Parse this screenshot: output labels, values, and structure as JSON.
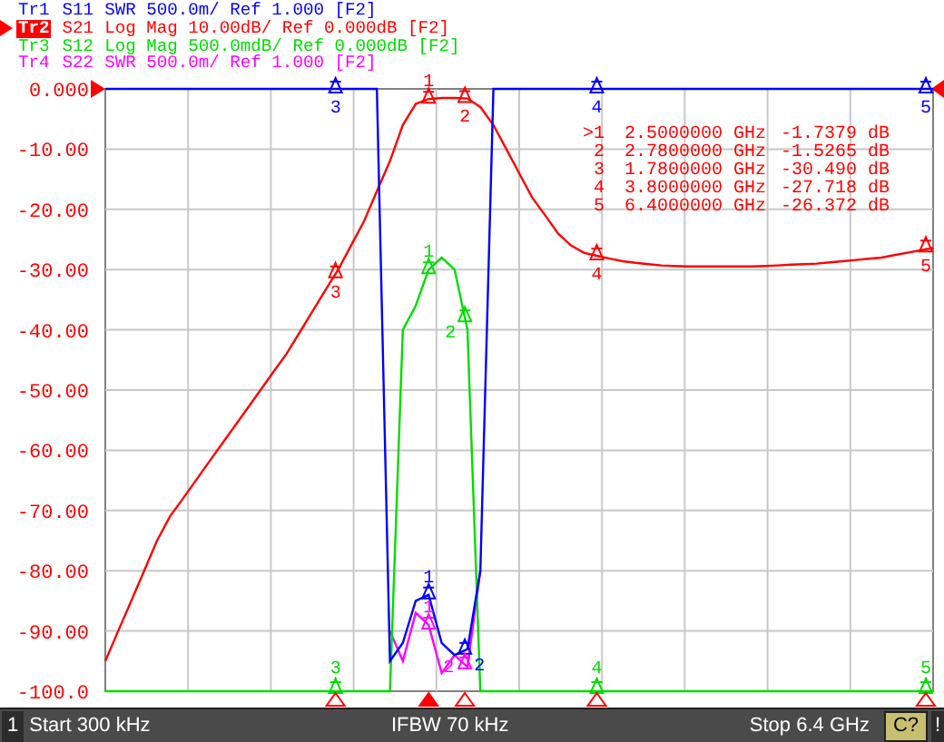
{
  "traces": [
    {
      "name": "Tr1",
      "format": "SWR 500.0m/ Ref 1.000 [F2]",
      "selected": false,
      "marker_labels": [
        "1",
        "2",
        "3",
        "4",
        "5"
      ]
    },
    {
      "name": "Tr2",
      "format": "Log Mag 10.00dB/ Ref 0.000dB [F2]",
      "selected": true,
      "marker_labels": [
        "1",
        "2",
        "3",
        "4",
        "5"
      ]
    },
    {
      "name": "Tr3",
      "format": "Log Mag 500.0mdB/ Ref 0.000dB [F2]",
      "selected": false,
      "marker_labels": [
        "1",
        "2",
        "3",
        "4",
        "5"
      ]
    },
    {
      "name": "Tr4",
      "format": "SWR 500.0m/ Ref 1.000 [F2]",
      "selected": false,
      "marker_labels": [
        "1",
        "2"
      ]
    }
  ],
  "plot": {
    "chart_data": {
      "type": "line",
      "grid": true,
      "ylim": [
        -100,
        0
      ],
      "yticks": [
        {
          "value": 0,
          "label": "0.000"
        },
        {
          "value": -10,
          "label": "-10.00"
        },
        {
          "value": -20,
          "label": "-20.00"
        },
        {
          "value": -30,
          "label": "-30.00"
        },
        {
          "value": -40,
          "label": "-40.00"
        },
        {
          "value": -50,
          "label": "-50.00"
        },
        {
          "value": -60,
          "label": "-60.00"
        },
        {
          "value": -70,
          "label": "-70.00"
        },
        {
          "value": -80,
          "label": "-80.00"
        },
        {
          "value": -90,
          "label": "-90.00"
        },
        {
          "value": -100,
          "label": "-100.0"
        }
      ],
      "categories": [
        null,
        null,
        null,
        null,
        null,
        null,
        null,
        null,
        null,
        null,
        null,
        null,
        null,
        null,
        null,
        null,
        null,
        null,
        null,
        null,
        null,
        null,
        null,
        null,
        null,
        null,
        null,
        null,
        null,
        null,
        null,
        null,
        null,
        null,
        null,
        null,
        null,
        null,
        null,
        null,
        null,
        null,
        null,
        null,
        null,
        null,
        null,
        null,
        null,
        null,
        null,
        null,
        null,
        null,
        null,
        null,
        null,
        null,
        null,
        null,
        null,
        null,
        null,
        null,
        null
      ],
      "series": [
        {
          "name": "S11",
          "color": "#0000ff",
          "values": [
            0,
            0,
            0,
            0,
            0,
            0,
            0,
            0,
            0,
            0,
            0,
            0,
            0,
            0,
            0,
            0,
            0,
            0,
            0,
            0,
            0,
            0,
            -95,
            -92,
            -85,
            -84,
            -92,
            -94,
            -93,
            -80,
            0,
            0,
            0,
            0,
            0,
            0,
            0,
            0,
            0,
            0,
            0,
            0,
            0,
            0,
            0,
            0,
            0,
            0,
            0,
            0,
            0,
            0,
            0,
            0,
            0,
            0,
            0,
            0,
            0,
            0,
            0,
            0,
            0,
            0,
            0
          ]
        },
        {
          "name": "S21",
          "color": "#ff0000",
          "values": [
            -95,
            -90,
            -85,
            -80,
            -75,
            -71,
            -68,
            -65,
            -62,
            -59,
            -56,
            -53,
            -50,
            -47,
            -44,
            -40.5,
            -37,
            -33.5,
            -30,
            -26,
            -22,
            -17,
            -12,
            -6,
            -2.5,
            -1.7,
            -1.5,
            -1.5,
            -1.6,
            -3,
            -6,
            -10,
            -14,
            -18,
            -21,
            -24,
            -26,
            -27.2,
            -27.7,
            -28.2,
            -28.6,
            -28.9,
            -29.1,
            -29.3,
            -29.4,
            -29.5,
            -29.5,
            -29.5,
            -29.5,
            -29.5,
            -29.5,
            -29.4,
            -29.3,
            -29.2,
            -29.1,
            -29,
            -28.8,
            -28.6,
            -28.4,
            -28.2,
            -28,
            -27.6,
            -27.2,
            -26.8,
            -26.4
          ]
        },
        {
          "name": "S12",
          "color": "#00dd00",
          "values": [
            -100,
            -100,
            -100,
            -100,
            -100,
            -100,
            -100,
            -100,
            -100,
            -100,
            -100,
            -100,
            -100,
            -100,
            -100,
            -100,
            -100,
            -100,
            -100,
            -100,
            -100,
            -100,
            -100,
            -40,
            -36,
            -30,
            -28,
            -30,
            -40,
            -100,
            -100,
            -100,
            -100,
            -100,
            -100,
            -100,
            -100,
            -100,
            -100,
            -100,
            -100,
            -100,
            -100,
            -100,
            -100,
            -100,
            -100,
            -100,
            -100,
            -100,
            -100,
            -100,
            -100,
            -100,
            -100,
            -100,
            -100,
            -100,
            -100,
            -100,
            -100,
            -100,
            -100,
            -100,
            -100
          ]
        },
        {
          "name": "S22",
          "color": "#ff00ff",
          "values": [
            null,
            null,
            null,
            null,
            null,
            null,
            null,
            null,
            null,
            null,
            null,
            null,
            null,
            null,
            null,
            null,
            null,
            null,
            null,
            null,
            null,
            null,
            -90,
            -95,
            -87,
            -89,
            -97,
            -94,
            -96,
            -80,
            null,
            null,
            null,
            null,
            null,
            null,
            null,
            null,
            null,
            null,
            null,
            null,
            null,
            null,
            null,
            null,
            null,
            null,
            null,
            null,
            null,
            null,
            null,
            null,
            null,
            null,
            null,
            null,
            null,
            null,
            null,
            null,
            null,
            null,
            null
          ]
        }
      ]
    },
    "marker_table": [
      {
        "number": ">1",
        "frequency": "2.5000000 GHz",
        "value": "-1.7379 dB",
        "selected": true
      },
      {
        "number": "2",
        "frequency": "2.7800000 GHz",
        "value": "-1.5265 dB",
        "selected": false
      },
      {
        "number": "3",
        "frequency": "1.7800000 GHz",
        "value": "-30.490 dB",
        "selected": false
      },
      {
        "number": "4",
        "frequency": "3.8000000 GHz",
        "value": "-27.718 dB",
        "selected": false
      },
      {
        "number": "5",
        "frequency": "6.4000000 GHz",
        "value": "-26.372 dB",
        "selected": false
      }
    ]
  },
  "status_bar": {
    "channel": "1",
    "start": "Start 300 kHz",
    "ifbw": "IFBW 70 kHz",
    "stop": "Stop 6.4 GHz",
    "correction": "C?",
    "alert": "!"
  }
}
